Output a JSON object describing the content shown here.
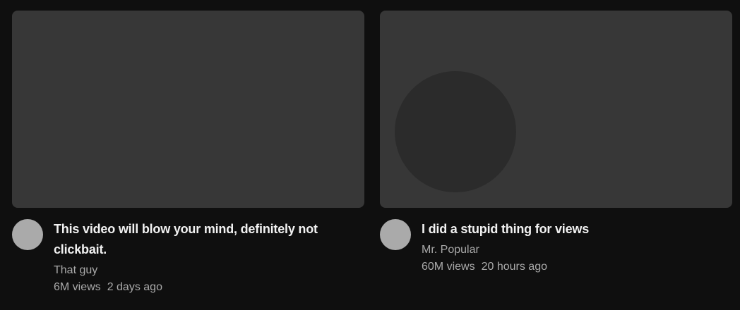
{
  "colors": {
    "background": "#0f0f0f",
    "thumbnail": "#373737",
    "thumbnail_shape": "#2b2b2b",
    "avatar": "#aaaaaa",
    "title": "#f1f1f1",
    "secondary_text": "#aaaaaa"
  },
  "videos": [
    {
      "title": "This video will blow your mind, definitely not clickbait.",
      "channel": "That guy",
      "views": "6M views",
      "age": "2 days ago"
    },
    {
      "title": "I did a stupid thing for views",
      "channel": "Mr. Popular",
      "views": "60M views",
      "age": "20 hours ago"
    }
  ]
}
